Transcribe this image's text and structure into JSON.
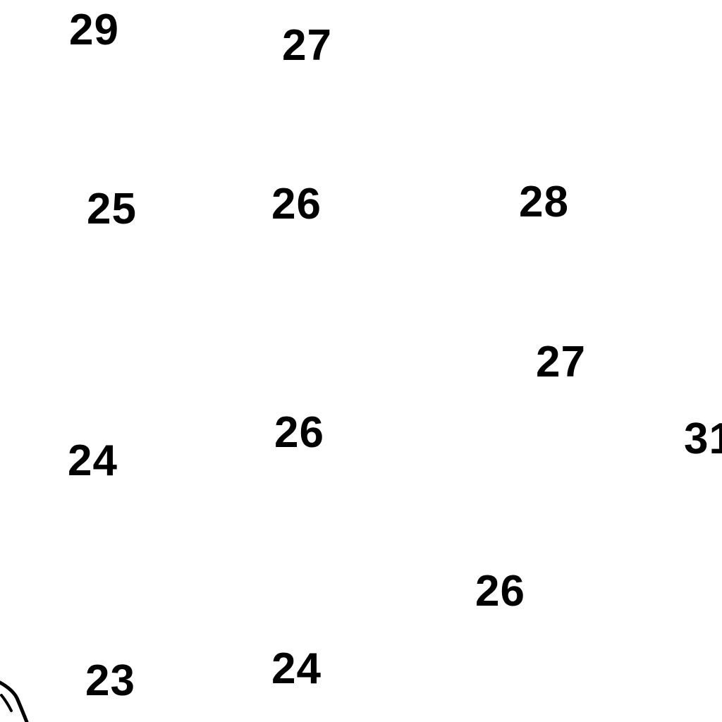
{
  "map": {
    "text_color": "#000000",
    "background": "#ffffff",
    "labels": [
      "29",
      "27",
      "25",
      "26",
      "28",
      "27",
      "26",
      "24",
      "31",
      "26",
      "23",
      "24"
    ]
  }
}
